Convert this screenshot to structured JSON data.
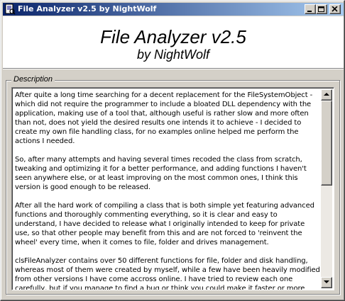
{
  "window": {
    "title": "File Analyzer v2.5 by NightWolf",
    "icon": "app-icon"
  },
  "header": {
    "app_title": "File Analyzer v2.5",
    "app_author": "by NightWolf"
  },
  "description": {
    "label": "Description",
    "paragraphs": [
      "After quite a long time searching for a decent replacement for the FileSystemObject - which did not require the programmer to include a bloated DLL dependency with the application, making use of a tool that, although useful is rather slow and more often than not, does not yield the desired results one intends it to achieve - I decided to create my own file handling class, for no examples online helped me perform the actions I needed.",
      "So, after many attempts and having several times recoded the class from scratch, tweaking and optimizing it for a better performance, and adding functions I haven't seen anywhere else, or at least improving on the most common ones, I think this version is good enough to be released.",
      "After all the hard work of compiling a class that is both simple yet featuring advanced functions and thoroughly commenting everything, so it is clear and easy to understand, I have decided to release what I originally intended to keep for private use, so that other people may benefit from this and are not forced to 'reinvent the wheel' every time, when it comes to file, folder and drives management.",
      "clsFileAnalyzer contains over 50 different functions for file, folder and disk handling, whereas most of them were created by myself, while a few have been heavily modified from other versions I have come accross online. I have tried to review each one carefully, but if you manage to find a bug or think you could make it faster or more"
    ],
    "scroll_position": 0.0
  }
}
